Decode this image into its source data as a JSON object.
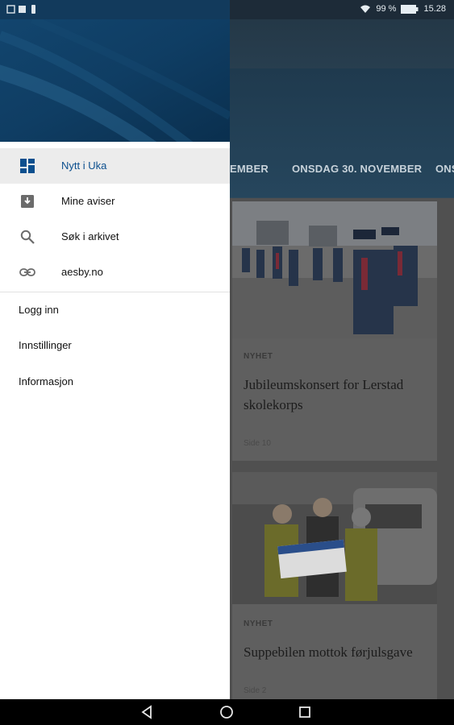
{
  "status_bar": {
    "battery": "99 %",
    "time": "15.28"
  },
  "drawer": {
    "menu": [
      {
        "label": "Nytt i Uka",
        "icon": "dashboard-icon",
        "active": true
      },
      {
        "label": "Mine aviser",
        "icon": "archive-box-icon",
        "active": false
      },
      {
        "label": "Søk i arkivet",
        "icon": "search-icon",
        "active": false
      },
      {
        "label": "aesby.no",
        "icon": "link-icon",
        "active": false
      }
    ],
    "secondary": [
      {
        "label": "Logg inn"
      },
      {
        "label": "Innstillinger"
      },
      {
        "label": "Informasjon"
      }
    ]
  },
  "background_app": {
    "tabs": [
      "EMBER",
      "ONSDAG 30. NOVEMBER",
      "ONS"
    ],
    "articles": [
      {
        "kicker": "NYHET",
        "title": "Jubileumskonsert for Lerstad skolekorps",
        "page": "Side 10"
      },
      {
        "kicker": "NYHET",
        "title": "Suppebilen mottok førjulsgave",
        "page": "Side 2"
      }
    ]
  },
  "colors": {
    "drawer_accent": "#0c4f8e",
    "header_blue": "#0e3a5f",
    "scrim": "#505050"
  }
}
